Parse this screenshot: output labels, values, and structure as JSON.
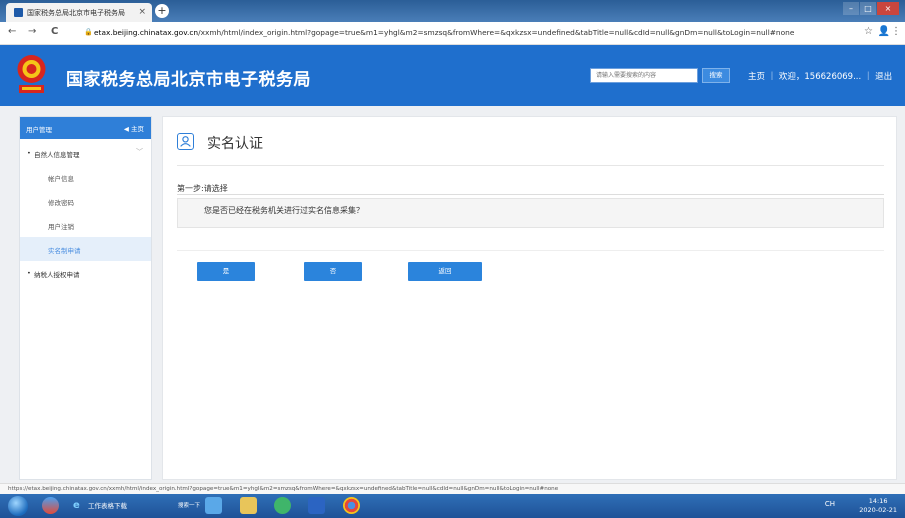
{
  "browser": {
    "tab_title": "国家税务总局北京市电子税务局",
    "tab_close": "×",
    "new_tab": "+",
    "back": "←",
    "forward": "→",
    "reload": "C",
    "url_host": "etax.beijing.chinatax.gov.cn",
    "url_path": "/xxmh/html/index_origin.html?gopage=true&m1=yhgl&m2=smzsq&fromWhere=&qxkzsx=undefined&tabTitle=null&cdId=null&gnDm=null&toLogin=null#none",
    "star": "☆",
    "profile": "👤",
    "menu": "⋮",
    "status_url": "https://etax.beijing.chinatax.gov.cn/xxmh/html/index_origin.html?gopage=true&m1=yhgl&m2=smzsq&fromWhere=&qxkzsx=undefined&tabTitle=null&cdId=null&gnDm=null&toLogin=null#none"
  },
  "header": {
    "site_title": "国家税务总局北京市电子税务局",
    "search_placeholder": "请输入需要搜索的内容",
    "search_button": "搜索",
    "top_links": "主页 ｜ 欢迎，156626069... ｜ 退出"
  },
  "sidebar": {
    "title": "用户管理",
    "home": "◀ 主页",
    "items": [
      {
        "label": "自然人信息管理",
        "bullet": "•",
        "chevron": "﹀"
      },
      {
        "label": "帐户信息"
      },
      {
        "label": "修改密码"
      },
      {
        "label": "用户注销"
      },
      {
        "label": "实名制申请"
      },
      {
        "label": "纳税人授权申请",
        "bullet": "•"
      }
    ]
  },
  "main": {
    "page_title": "实名认证",
    "step_label": "第一步:请选择",
    "question": "您是否已经在税务机关进行过实名信息采集？",
    "buttons": {
      "yes": "是",
      "no": "否",
      "back": "返回"
    }
  },
  "taskbar": {
    "task_item_1": "工作表格下载",
    "task_item_2": "搜索一下",
    "tray": "CH",
    "clock_time": "14:16",
    "clock_date": "2020-02-21"
  },
  "colors": {
    "brand_blue": "#1f6fcd",
    "button_blue": "#2b84dc",
    "active_item": "#4a8ee0"
  }
}
